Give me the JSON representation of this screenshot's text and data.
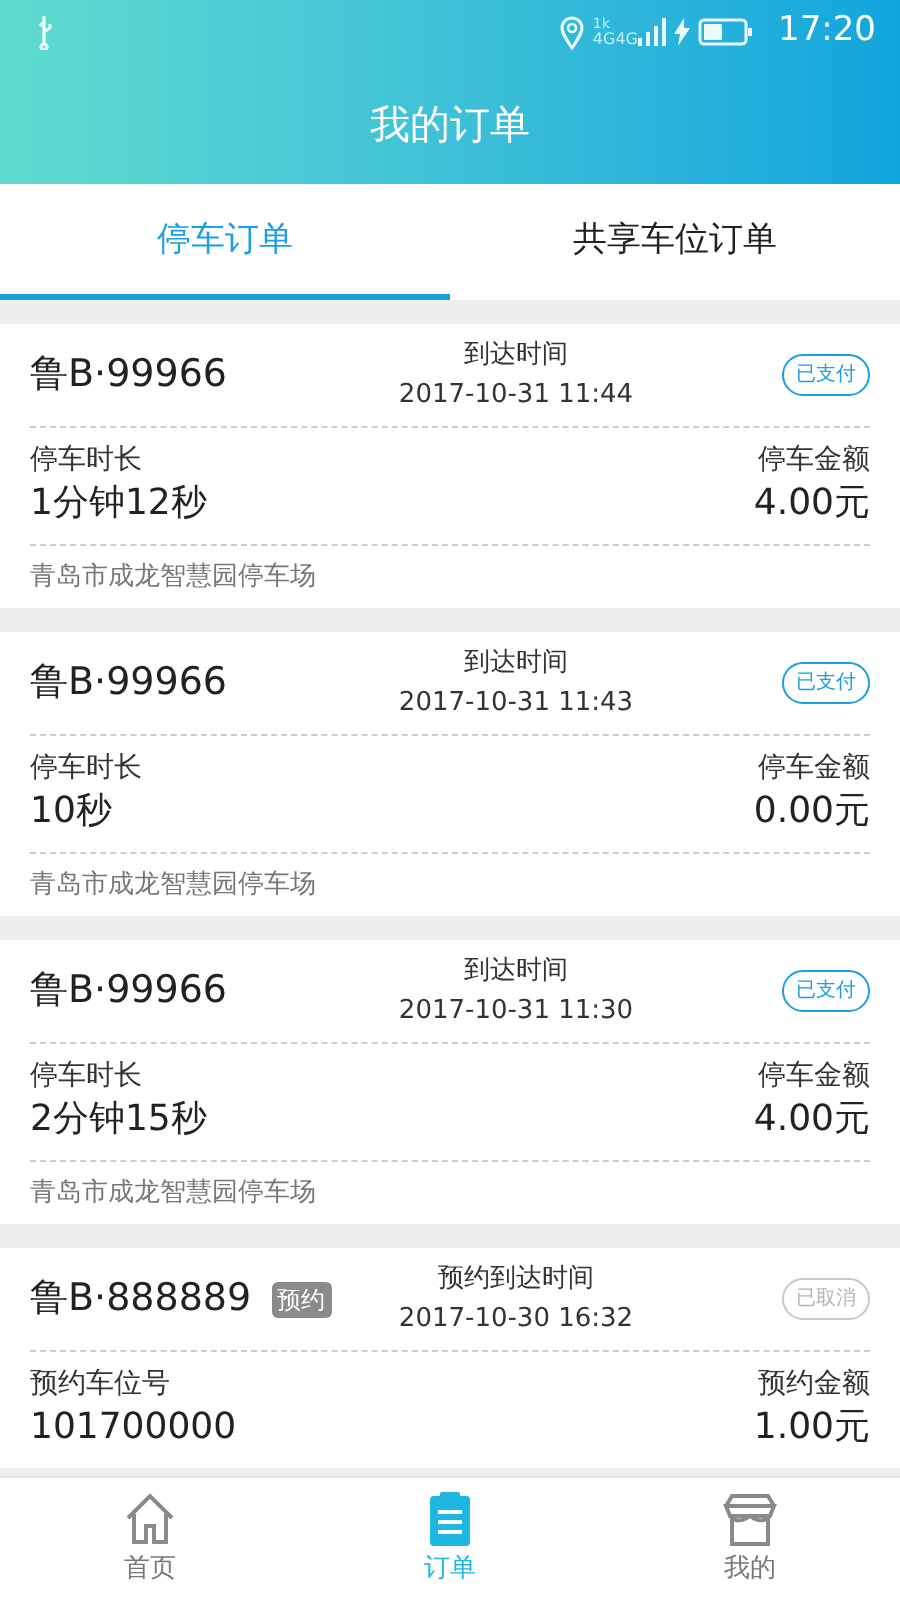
{
  "status_bar": {
    "speed": "1k",
    "network": "4G4G",
    "time": "17:20"
  },
  "header": {
    "title": "我的订单"
  },
  "tabs": [
    {
      "label": "停车订单",
      "selected": true
    },
    {
      "label": "共享车位订单",
      "selected": false
    }
  ],
  "orders": [
    {
      "plate": "鲁B·99966",
      "time_label": "到达时间",
      "time": "2017-10-31 11:44",
      "cancelled": false,
      "status_text": "已支付",
      "left_label": "停车时长",
      "left_value": "1分钟12秒",
      "right_label": "停车金额",
      "right_value": "4.00元",
      "location": "青岛市成龙智慧园停车场"
    },
    {
      "plate": "鲁B·99966",
      "time_label": "到达时间",
      "time": "2017-10-31 11:43",
      "cancelled": false,
      "status_text": "已支付",
      "left_label": "停车时长",
      "left_value": "10秒",
      "right_label": "停车金额",
      "right_value": "0.00元",
      "location": "青岛市成龙智慧园停车场"
    },
    {
      "plate": "鲁B·99966",
      "time_label": "到达时间",
      "time": "2017-10-31 11:30",
      "cancelled": false,
      "status_text": "已支付",
      "left_label": "停车时长",
      "left_value": "2分钟15秒",
      "right_label": "停车金额",
      "right_value": "4.00元",
      "location": "青岛市成龙智慧园停车场"
    },
    {
      "plate": "鲁B·888889",
      "tag": "预约",
      "time_label": "预约到达时间",
      "time": "2017-10-30 16:32",
      "cancelled": true,
      "status_text": "已取消",
      "left_label": "预约车位号",
      "left_value": "101700000",
      "right_label": "预约金额",
      "right_value": "1.00元"
    }
  ],
  "bottom_nav": [
    {
      "label": "首页",
      "selected": false
    },
    {
      "label": "订单",
      "selected": true
    },
    {
      "label": "我的",
      "selected": false
    }
  ]
}
